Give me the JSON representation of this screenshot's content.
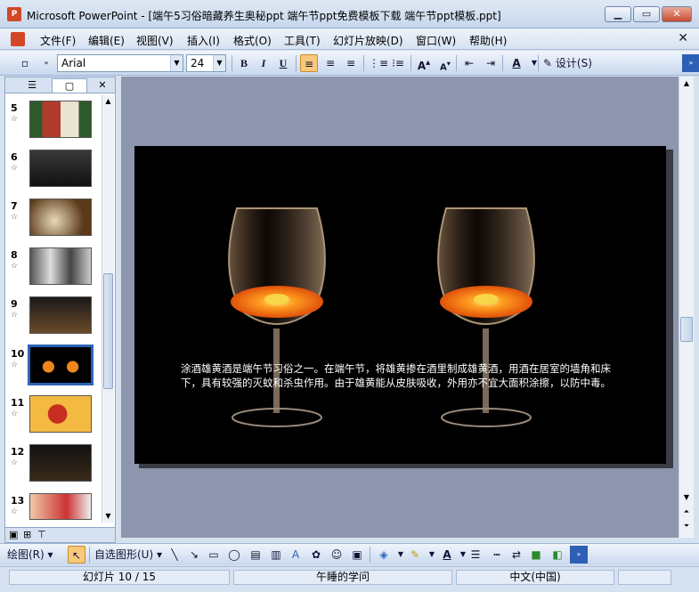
{
  "window": {
    "app_icon": "powerpoint-icon",
    "title": "Microsoft PowerPoint - [端午5习俗暗藏养生奥秘ppt 端午节ppt免费模板下载 端午节ppt模板.ppt]",
    "buttons": [
      "minimize",
      "maximize",
      "close"
    ]
  },
  "menu": {
    "items": [
      "文件(F)",
      "编辑(E)",
      "视图(V)",
      "插入(I)",
      "格式(O)",
      "工具(T)",
      "幻灯片放映(D)",
      "窗口(W)",
      "帮助(H)"
    ],
    "close_glyph": "✕"
  },
  "toolbar": {
    "font_name": "Arial",
    "font_size": "24",
    "bold": "B",
    "italic": "I",
    "underline": "U",
    "font_color": "A",
    "design_label": "设计(S)"
  },
  "slides_pane": {
    "tab_outline_icon": "outline-icon",
    "tab_slides_icon": "slides-icon",
    "close_glyph": "✕",
    "thumbnails": [
      {
        "number": "5",
        "star": "☆"
      },
      {
        "number": "6",
        "star": "☆"
      },
      {
        "number": "7",
        "star": "☆"
      },
      {
        "number": "8",
        "star": "☆"
      },
      {
        "number": "9",
        "star": "☆"
      },
      {
        "number": "10",
        "star": "☆"
      },
      {
        "number": "11",
        "star": "☆"
      },
      {
        "number": "12",
        "star": "☆"
      },
      {
        "number": "13",
        "star": "☆"
      }
    ],
    "selected": "10"
  },
  "slide": {
    "text": "涂酒雄黄酒是端午节习俗之一。在端午节，将雄黄掺在酒里制成雄黄酒，用酒在居室的墙角和床下，具有较强的灭蚊和杀虫作用。由于雄黄能从皮肤吸收，外用亦不宜大面积涂擦，以防中毒。"
  },
  "drawbar": {
    "draw_label": "绘图(R)",
    "autoshapes_label": "自选图形(U)"
  },
  "status": {
    "slide_pos": "幻灯片 10 / 15",
    "design_name": "午睡的学问",
    "language": "中文(中国)"
  }
}
